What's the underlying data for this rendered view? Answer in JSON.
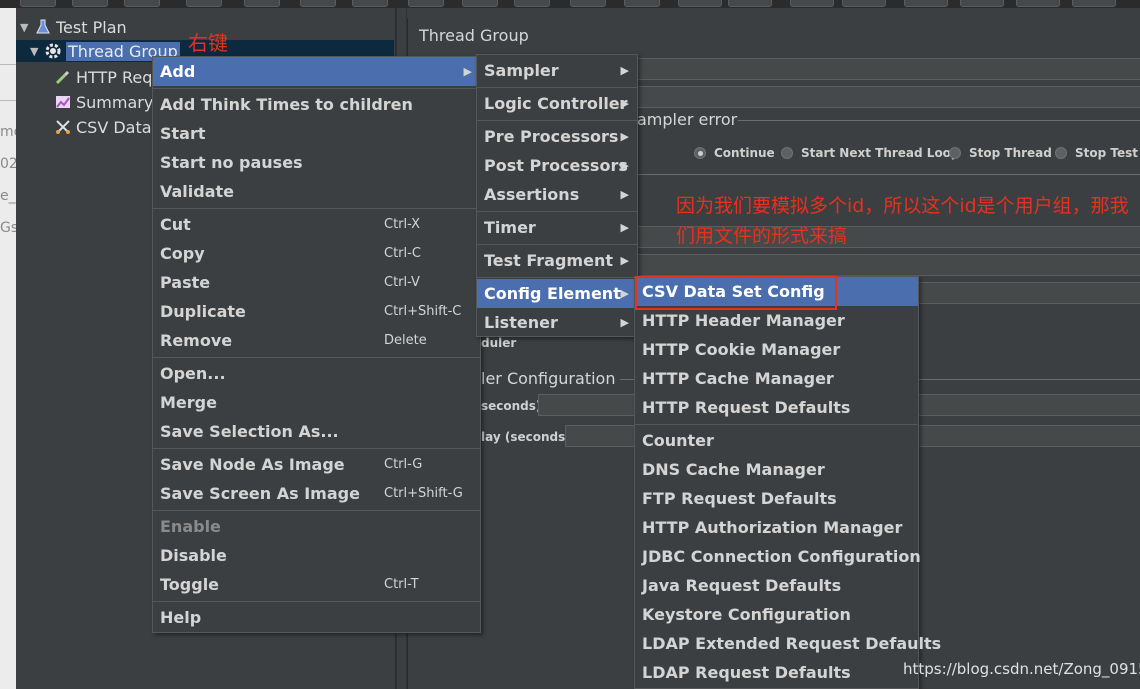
{
  "tree": {
    "items": [
      {
        "label": "Test Plan",
        "icon": "flask-icon"
      },
      {
        "label": "Thread Group",
        "icon": "gear-icon"
      },
      {
        "label": "HTTP Requ",
        "icon": "dropper-icon"
      },
      {
        "label": "Summary R",
        "icon": "chart-icon"
      },
      {
        "label": "CSV Data",
        "icon": "scissors-icon"
      }
    ]
  },
  "editor": {
    "title": "Thread Group",
    "sampler_error_label": "ampler error",
    "radio_options": [
      "Continue",
      "Start Next Thread Loop",
      "Stop Thread",
      "Stop Test"
    ],
    "scheduler_label": "duler",
    "scheduler_config": "ler Configuration",
    "duration_label": "seconds)",
    "startup_delay_label": "lay (seconds)"
  },
  "left_strip": {
    "fragments": [
      "mc",
      "02",
      "e_",
      "Gs"
    ]
  },
  "context_menu": {
    "groups": [
      [
        {
          "label": "Add",
          "submenu": true,
          "highlighted": true
        }
      ],
      [
        {
          "label": "Add Think Times to children"
        },
        {
          "label": "Start"
        },
        {
          "label": "Start no pauses"
        },
        {
          "label": "Validate"
        }
      ],
      [
        {
          "label": "Cut",
          "shortcut": "Ctrl-X"
        },
        {
          "label": "Copy",
          "shortcut": "Ctrl-C"
        },
        {
          "label": "Paste",
          "shortcut": "Ctrl-V"
        },
        {
          "label": "Duplicate",
          "shortcut": "Ctrl+Shift-C"
        },
        {
          "label": "Remove",
          "shortcut": "Delete"
        }
      ],
      [
        {
          "label": "Open..."
        },
        {
          "label": "Merge"
        },
        {
          "label": "Save Selection As..."
        }
      ],
      [
        {
          "label": "Save Node As Image",
          "shortcut": "Ctrl-G"
        },
        {
          "label": "Save Screen As Image",
          "shortcut": "Ctrl+Shift-G"
        }
      ],
      [
        {
          "label": "Enable",
          "disabled": true
        },
        {
          "label": "Disable"
        },
        {
          "label": "Toggle",
          "shortcut": "Ctrl-T"
        }
      ],
      [
        {
          "label": "Help"
        }
      ]
    ]
  },
  "add_submenu": {
    "groups": [
      [
        {
          "label": "Sampler",
          "submenu": true
        }
      ],
      [
        {
          "label": "Logic Controller",
          "submenu": true
        }
      ],
      [
        {
          "label": "Pre Processors",
          "submenu": true
        },
        {
          "label": "Post Processors",
          "submenu": true
        },
        {
          "label": "Assertions",
          "submenu": true
        }
      ],
      [
        {
          "label": "Timer",
          "submenu": true
        }
      ],
      [
        {
          "label": "Test Fragment",
          "submenu": true
        }
      ],
      [
        {
          "label": "Config Element",
          "submenu": true,
          "highlighted": true
        },
        {
          "label": "Listener",
          "submenu": true
        }
      ]
    ]
  },
  "config_submenu": {
    "groups": [
      [
        {
          "label": "CSV Data Set Config",
          "highlighted": true
        },
        {
          "label": "HTTP Header Manager"
        },
        {
          "label": "HTTP Cookie Manager"
        },
        {
          "label": "HTTP Cache Manager"
        },
        {
          "label": "HTTP Request Defaults"
        }
      ],
      [
        {
          "label": "Counter"
        },
        {
          "label": "DNS Cache Manager"
        },
        {
          "label": "FTP Request Defaults"
        },
        {
          "label": "HTTP Authorization Manager"
        },
        {
          "label": "JDBC Connection Configuration"
        },
        {
          "label": "Java Request Defaults"
        },
        {
          "label": "Keystore Configuration"
        },
        {
          "label": "LDAP Extended Request Defaults"
        },
        {
          "label": "LDAP Request Defaults"
        }
      ]
    ]
  },
  "annotations": {
    "right_click": "右键",
    "note": "因为我们要模拟多个id，所以这个id是个用户组，那我们用文件的形式来搞"
  },
  "watermark": "https://blog.csdn.net/Zong_0915",
  "colors": {
    "highlight": "#4b6eaf",
    "annotation": "#e8301e",
    "background": "#3c3f41"
  }
}
